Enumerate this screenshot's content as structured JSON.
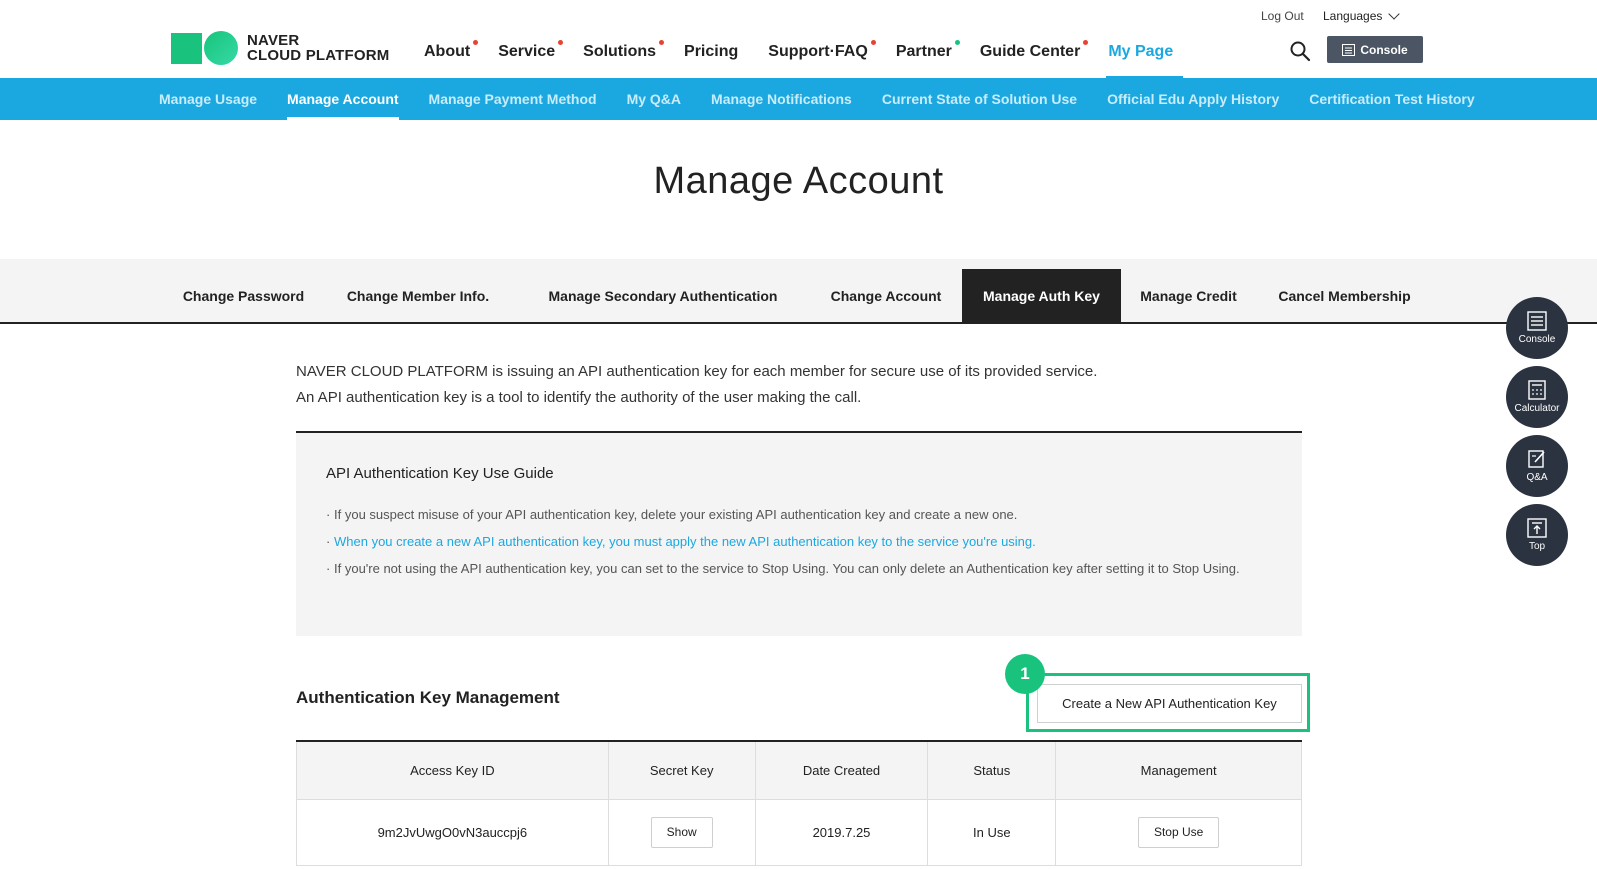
{
  "header": {
    "logo_line1": "NAVER",
    "logo_line2": "CLOUD PLATFORM",
    "nav": [
      {
        "label": "About",
        "dot": "red"
      },
      {
        "label": "Service",
        "dot": "red"
      },
      {
        "label": "Solutions",
        "dot": "red"
      },
      {
        "label": "Pricing",
        "dot": ""
      },
      {
        "label": "Support·FAQ",
        "dot": "red"
      },
      {
        "label": "Partner",
        "dot": "green"
      },
      {
        "label": "Guide Center",
        "dot": "red"
      },
      {
        "label": "My Page",
        "dot": "",
        "active": true
      }
    ],
    "logout": "Log Out",
    "languages": "Languages",
    "console": "Console"
  },
  "subnav": {
    "items": [
      "Manage Usage",
      "Manage Account",
      "Manage Payment Method",
      "My Q&A",
      "Manage Notifications",
      "Current State of Solution Use",
      "Official Edu Apply History",
      "Certification Test History"
    ],
    "active_index": 1
  },
  "page": {
    "title": "Manage Account"
  },
  "tabs": {
    "items": [
      "Change Password",
      "Change Member Info.",
      "Manage Secondary Authentication",
      "Change Account",
      "Manage Auth Key",
      "Manage Credit",
      "Cancel Membership"
    ],
    "active_index": 4
  },
  "intro": {
    "line1": "NAVER CLOUD PLATFORM is issuing an API authentication key for each member for secure use of its provided service.",
    "line2": "An API authentication key is a tool to identify the authority of the user making the call."
  },
  "guide": {
    "title": "API Authentication Key Use Guide",
    "items": [
      "If you suspect misuse of your API authentication key, delete your existing API authentication key and create a new one.",
      "When you create a new API authentication key, you must apply the new API authentication key to the service you're using.",
      "If you're not using the API authentication key, you can set to the service to Stop Using. You can only delete an Authentication key after setting it to Stop Using."
    ]
  },
  "keys": {
    "section_title": "Authentication Key Management",
    "create_button": "Create a New API Authentication Key",
    "step_number": "1",
    "columns": [
      "Access Key ID",
      "Secret Key",
      "Date Created",
      "Status",
      "Management"
    ],
    "rows": [
      {
        "access_key_id": "9m2JvUwgO0vN3auccpj6",
        "secret_key_button": "Show",
        "date_created": "2019.7.25",
        "status": "In Use",
        "management_button": "Stop Use"
      }
    ]
  },
  "floating_menu": {
    "console": "Console",
    "calculator": "Calculator",
    "qa": "Q&A",
    "top": "Top"
  },
  "colors": {
    "brand_green": "#19c37d",
    "brand_blue": "#1ba8e0",
    "dark": "#222222",
    "dot_red": "#e8432f",
    "dot_green": "#19c37d"
  }
}
